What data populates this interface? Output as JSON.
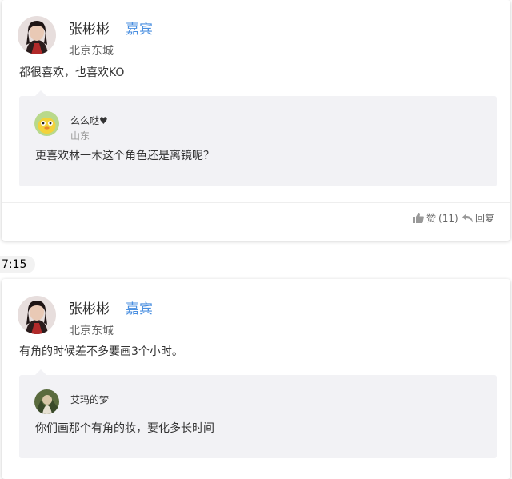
{
  "colors": {
    "role_badge": "#4a8fe0",
    "quote_bg": "#f2f2f5"
  },
  "comments": [
    {
      "author": "张彬彬",
      "role_badge": "嘉宾",
      "location": "北京东城",
      "text": "都很喜欢，也喜欢KO",
      "quote": {
        "author": "么么哒♥",
        "location": "山东",
        "text": "更喜欢林一木这个角色还是离镜呢？"
      },
      "actions": {
        "like_label": "赞",
        "like_count": "(11)",
        "reply_label": "回复"
      }
    },
    {
      "author": "张彬彬",
      "role_badge": "嘉宾",
      "location": "北京东城",
      "text": "有角的时候差不多要画3个小时。",
      "quote": {
        "author": "艾玛的梦",
        "text": "你们画那个有角的妆，要化多长时间"
      }
    }
  ],
  "time_label": "7:15",
  "icons": {
    "like": "thumbs-up-icon",
    "reply": "reply-icon"
  }
}
